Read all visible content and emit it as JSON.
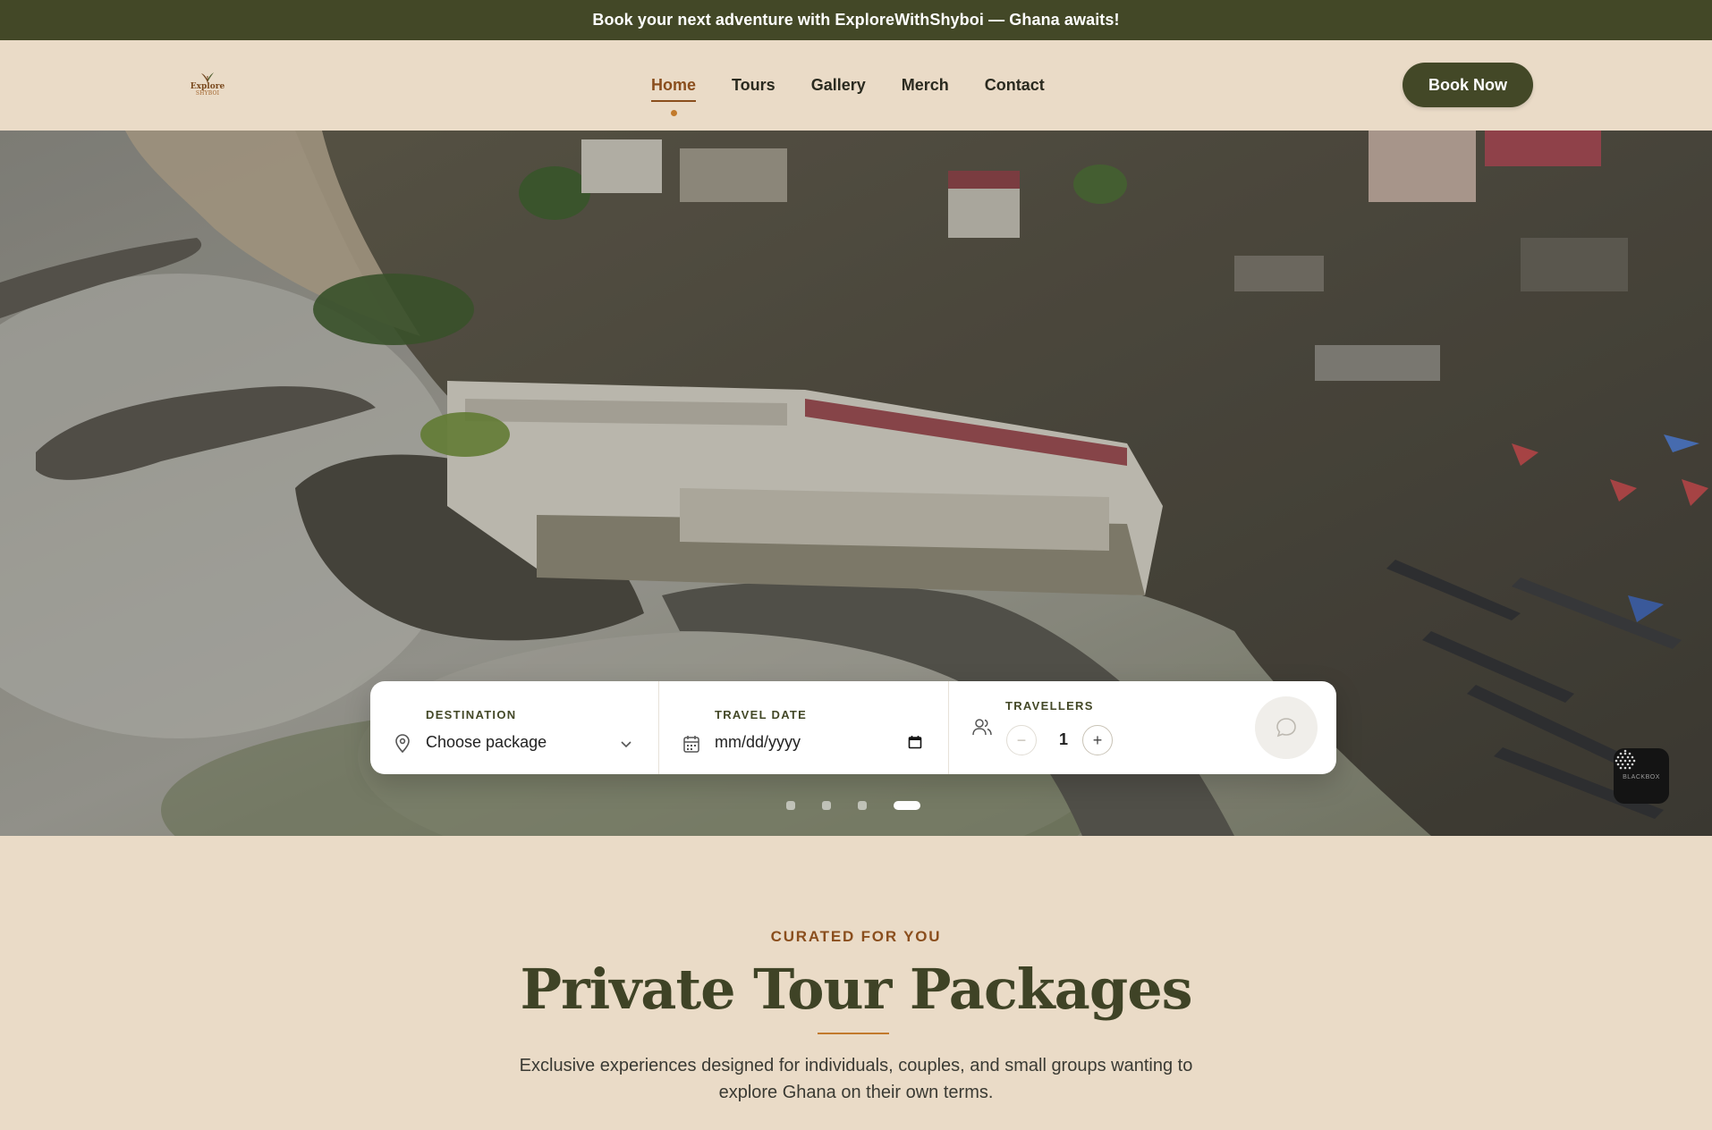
{
  "announcement": "Book your next adventure with ExploreWithShyboi — Ghana awaits!",
  "logo": {
    "line1": "Explore",
    "line2": "SHYBOI"
  },
  "nav": [
    {
      "label": "Home",
      "active": true
    },
    {
      "label": "Tours",
      "active": false
    },
    {
      "label": "Gallery",
      "active": false
    },
    {
      "label": "Merch",
      "active": false
    },
    {
      "label": "Contact",
      "active": false
    }
  ],
  "book_button": "Book Now",
  "search": {
    "destination": {
      "label": "DESTINATION",
      "value": "Choose package"
    },
    "travel_date": {
      "label": "TRAVEL DATE",
      "value": "mm/dd/yyyy"
    },
    "travellers": {
      "label": "TRAVELLERS",
      "count": "1",
      "minus": "−",
      "plus": "+"
    }
  },
  "carousel": {
    "slides": 4,
    "active_index": 3
  },
  "badge": {
    "text": "BLACKBOX"
  },
  "section": {
    "eyebrow": "CURATED FOR YOU",
    "title": "Private Tour Packages",
    "description": "Exclusive experiences designed for individuals, couples, and small groups wanting to explore Ghana on their own terms."
  },
  "colors": {
    "olive": "#434827",
    "sand": "#eadbc7",
    "accent": "#8a4e1d",
    "gold": "#c27a2c"
  }
}
